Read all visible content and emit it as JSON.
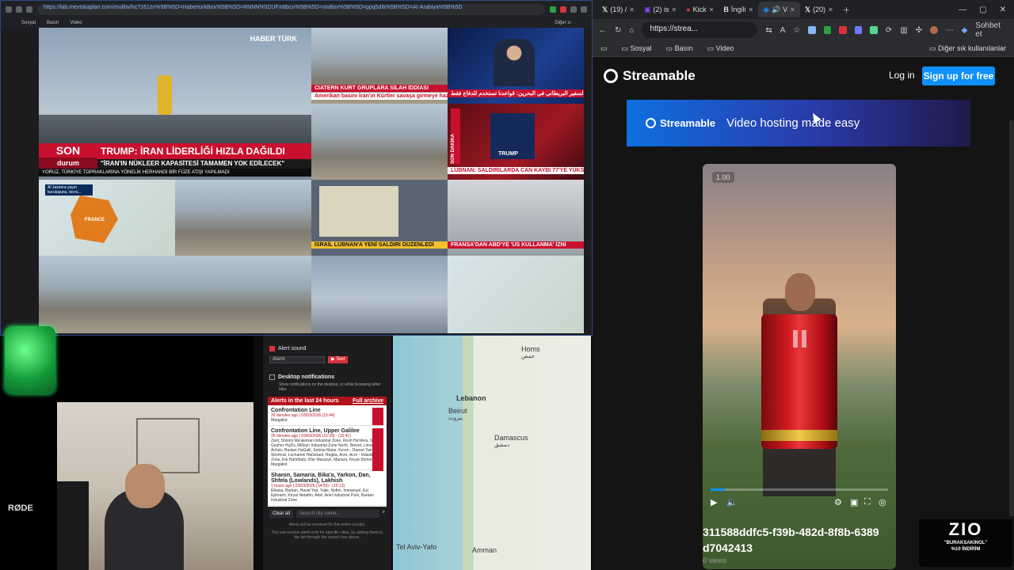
{
  "left_browser": {
    "url": "https://lab.mevtskaplan.com/multitv/hc?161zn%5B%5D=HaberturkBox%5B%5D=RNNN%5DUFxt8bcn%5B%5D=ntvBox%5B%5D=ppq5dIk%5B%5D=AI-Arabiya%5B%5D",
    "bookmarks": [
      "Sosyal",
      "Basın",
      "Video"
    ],
    "other_bookmarks": "Diğer sı"
  },
  "news": {
    "haberturk_logo": "HABER TÜRK",
    "son_label": "SON",
    "durum_label": "durum",
    "headline": "TRUMP: İRAN LİDERLİĞİ HIZLA DAĞILDI",
    "subheadline": "\"İRAN'IN NÜKLEER KAPASİTESİ TAMAMEN YOK EDİLECEK\"",
    "crawl": "YORUZ, TÜRKİYE TOPRAKLARINA YÖNELİK HERHANGİ BİR FÜZE ATIŞI YAPILMADI",
    "crawl_time": "14:54",
    "tile_tickers": {
      "top_mid": "CIATERN KURT GRUPLARA SİLAH İDDİASI",
      "top_mid_sub": "Amerikan basını İran'ın Kürtler savaşa girmeye hazırlanıyor",
      "top_right": "السفير البريطاني في البحرين: قواعدنا تستخدم للدفاع فقط",
      "mid_right": "LÜBNAN: SALDIRILARDA CAN KAYBI 77'YE YÜKSELDİ",
      "map_left": "Al Jazeera yayın kuruluşuna, tecrü...",
      "map_left_country": "FRANCE",
      "israel": "İSRAİL LÜBNAN'A YENİ SALDIRI DÜZENLEDİ",
      "france": "FRANSA'DAN ABD'YE 'ÜS KULLANMA' İZNİ",
      "trump_box": "TRUMP",
      "son_dakika": "SON DAKİKA"
    }
  },
  "alerts": {
    "alert_sound_label": "Alert sound",
    "alarm_option": "Alarm",
    "test_label": "▶ Test",
    "desktop_notifications": "Desktop notifications",
    "desktop_desc": "Show notifications on the desktop, or while browsing other tabs",
    "last24_label": "Alerts in the last 24 hours",
    "full_archive": "Full archive",
    "items": [
      {
        "title": "Confrontation Line",
        "time": "20 minutes ago | 03/03/2026 (15:44)",
        "place": "Margaliot"
      },
      {
        "title": "Confrontation Line, Upper Galilee",
        "time": "25 minutes ago | 03/03/2026 (15:39) - (15:41)",
        "place": "Zarit, Shlomi Ma'aleman Industrial Zone, Rosh Ha'nikra, Sh'or, Gesher HaZiv, Milloun Industrial Zone North, Betzet, Liman, Hof Achziv, Bustan HaGalil, Setinio-Malar, Keren - Ramot Yam, Shomrat, Lochamei HaGetaot, Regba, Acre, Acre - Industrial Zone, Ein Hamifratz, Kfar Masaryk, Manara, Kiryat Shmona, Margaliot"
      },
      {
        "title": "Sharon, Samaria, Bika'a, Yarkon, Dan, Shfela (Lowlands), Lakhish",
        "time": "1 hours ago | 03/03/2026 (14:59) - (15:13)",
        "place": "Elkana, Barkan, Havat Yair, Yakir, Nofim, Immanuel, Ezi Ephraim, Kiryat Netafim, Ariel, Ariel Industrial Park, Barkan Industrial Zone"
      }
    ],
    "clear_all": "Clear all",
    "search_placeholder": "Search city name...",
    "footer_note": "Alerts will be received for the entire country.",
    "footer_note2": "You can receive alerts only for specific cities, by adding them to the list through the search box above."
  },
  "map": {
    "cities": [
      "Homs",
      "Lebanon",
      "Beirut",
      "Damascus",
      "Tel Aviv-Yafo",
      "Amman"
    ],
    "arabic_labels": [
      "حمص",
      "بيروت",
      "دمشق"
    ]
  },
  "cam": {
    "mic_brand": "RØDE"
  },
  "right_browser": {
    "tabs": [
      {
        "label": "(19) /"
      },
      {
        "label": "(2) is"
      },
      {
        "label": "Kick"
      },
      {
        "label": "İngili"
      },
      {
        "label": "V"
      },
      {
        "label": "(20)"
      }
    ],
    "url": "https://strea...",
    "sohbet": "Sohbet et",
    "bookmarks": [
      "Sosyal",
      "Basın",
      "Video"
    ],
    "other_bookmarks": "Diğer sık kullanılanlar"
  },
  "streamable": {
    "brand": "Streamable",
    "login": "Log in",
    "signup": "Sign up for free",
    "banner_brand": "Streamable",
    "banner_tagline": "Video hosting made easy",
    "playback_rate": "1.00",
    "progress": 0.08,
    "video_id": "311588ddfc5-f39b-482d-8f8b-6389 d7042413",
    "views": "0 views"
  },
  "overlay": {
    "logo_main": "ZIO",
    "promo_line1": "\"BURAKSAKINOL\"",
    "promo_line2": "%10 İNDİRİM"
  },
  "colors": {
    "accent_blue": "#0f90fa",
    "news_red": "#c8102e"
  }
}
